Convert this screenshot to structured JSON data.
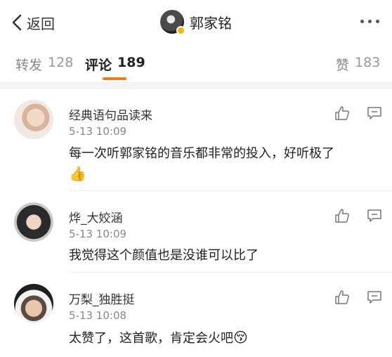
{
  "header": {
    "back_label": "返回",
    "title": "郭家铭"
  },
  "tabs": [
    {
      "label": "转发",
      "count": "128"
    },
    {
      "label": "评论",
      "count": "189"
    },
    {
      "label": "赞",
      "count": "183"
    }
  ],
  "accent_color": "#f27a1a",
  "comments": [
    {
      "name": "经典语句品读来",
      "time": "5-13 10:09",
      "text": "每一次听郭家铭的音乐都非常的投入，好听极了",
      "emoji": "👍"
    },
    {
      "name": "烨_大姣涵",
      "time": "5-13 10:09",
      "text": "我觉得这个颜值也是没谁可以比了",
      "emoji": ""
    },
    {
      "name": "万梨_独胜挺",
      "time": "5-13 10:08",
      "text": "太赞了，这首歌，肯定会火吧",
      "emoji": "😚"
    }
  ]
}
